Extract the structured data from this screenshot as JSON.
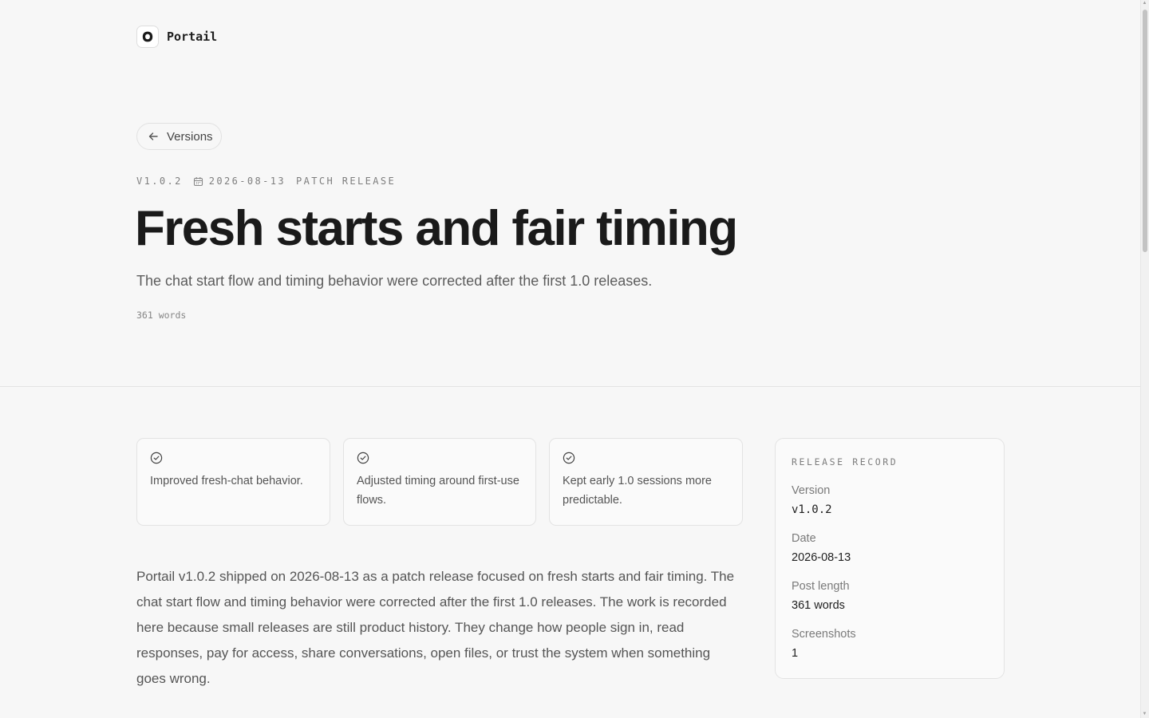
{
  "brand": {
    "name": "Portail"
  },
  "nav": {
    "back_label": "Versions"
  },
  "meta": {
    "version": "V1.0.2",
    "date": "2026-08-13",
    "kind": "PATCH RELEASE"
  },
  "hero": {
    "title": "Fresh starts and fair timing",
    "subtitle": "The chat start flow and timing behavior were corrected after the first 1.0 releases.",
    "word_count": "361 words"
  },
  "highlights": [
    {
      "icon": "check-circle-icon",
      "text": "Improved fresh-chat behavior."
    },
    {
      "icon": "check-circle-icon",
      "text": "Adjusted timing around first-use flows."
    },
    {
      "icon": "check-circle-icon",
      "text": "Kept early 1.0 sessions more predictable."
    }
  ],
  "body": {
    "paragraph": "Portail v1.0.2 shipped on 2026-08-13 as a patch release focused on fresh starts and fair timing. The chat start flow and timing behavior were corrected after the first 1.0 releases. The work is recorded here because small releases are still product history. They change how people sign in, read responses, pay for access, share conversations, open files, or trust the system when something goes wrong."
  },
  "record": {
    "heading": "RELEASE RECORD",
    "fields": [
      {
        "label": "Version",
        "value": "v1.0.2"
      },
      {
        "label": "Date",
        "value": "2026-08-13"
      },
      {
        "label": "Post length",
        "value": "361 words"
      },
      {
        "label": "Screenshots",
        "value": "1"
      }
    ]
  },
  "colors": {
    "background": "#f7f7f7",
    "text": "#1a1a1a",
    "muted": "#7e7e7e",
    "border": "#e3e3e3"
  }
}
